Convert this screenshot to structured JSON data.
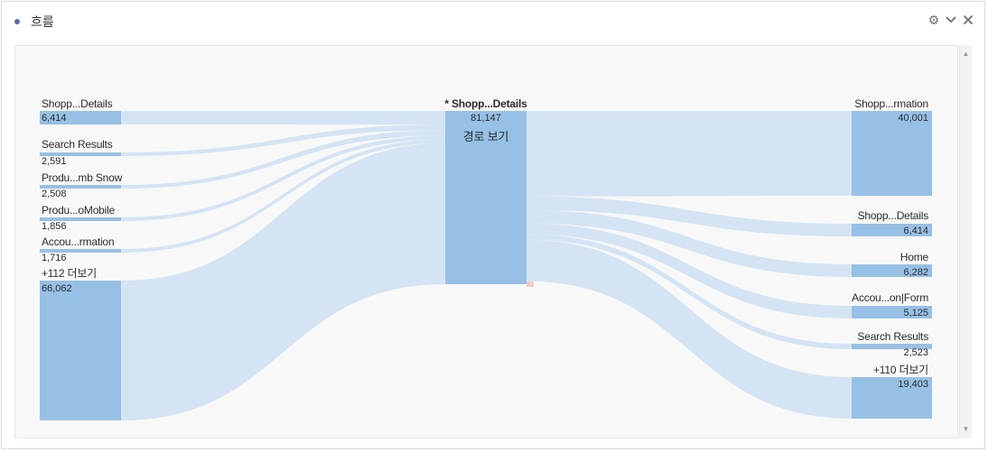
{
  "panel": {
    "title": "흐름"
  },
  "header_icons": [
    "gear-icon",
    "chevron-down-icon",
    "close-icon"
  ],
  "colors": {
    "node": "#97c0e6",
    "link": "#d4e4f4",
    "accent_dot": "#5a6bb0",
    "marker": "#f6c9c9"
  },
  "chart_data": {
    "type": "flow",
    "focus": {
      "label": "* Shopp...Details",
      "value": "81,147",
      "sub": "경로 보기"
    },
    "left": [
      {
        "label": "Shopp...Details",
        "value": "6,414"
      },
      {
        "label": "Search Results",
        "value": "2,591"
      },
      {
        "label": "Produ...mb Snow",
        "value": "2,508"
      },
      {
        "label": "Produ...oMobile",
        "value": "1,856"
      },
      {
        "label": "Accou...rmation",
        "value": "1,716"
      },
      {
        "label": "+112 더보기",
        "value": "66,062"
      }
    ],
    "right": [
      {
        "label": "Shopp...rmation",
        "value": "40,001"
      },
      {
        "label": "Shopp...Details",
        "value": "6,414"
      },
      {
        "label": "Home",
        "value": "6,282"
      },
      {
        "label": "Accou...on|Form",
        "value": "5,125"
      },
      {
        "label": "Search Results",
        "value": "2,523"
      },
      {
        "label": "+110 더보기",
        "value": "19,403"
      }
    ]
  }
}
